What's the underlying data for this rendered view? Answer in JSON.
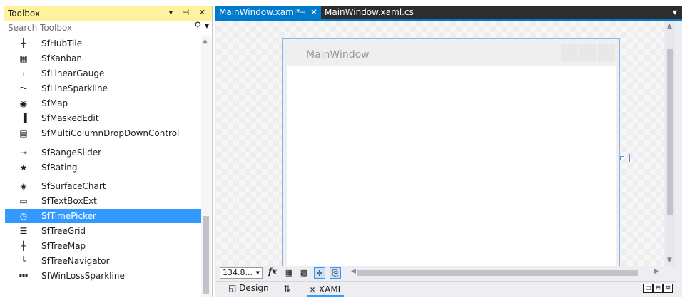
{
  "toolbox": {
    "title": "Toolbox",
    "controls": "▾ ⊣ ✕",
    "search_placeholder": "Search Toolbox",
    "items": [
      {
        "label": "SfHubTile",
        "icon": "hubtile-icon",
        "glyph": "╋"
      },
      {
        "label": "SfKanban",
        "icon": "kanban-icon",
        "glyph": "▦"
      },
      {
        "label": "SfLinearGauge",
        "icon": "linear-gauge-icon",
        "glyph": "ₗ"
      },
      {
        "label": "SfLineSparkline",
        "icon": "sparkline-icon",
        "glyph": "〜"
      },
      {
        "label": "SfMap",
        "icon": "map-icon",
        "glyph": "◉"
      },
      {
        "label": "SfMaskedEdit",
        "icon": "masked-edit-icon",
        "glyph": "▐"
      },
      {
        "label": "SfMultiColumnDropDownControl",
        "icon": "multicolumn-dropdown-icon",
        "glyph": "▤"
      },
      {
        "label": "SfRangeSlider",
        "icon": "range-slider-icon",
        "glyph": "⊸"
      },
      {
        "label": "SfRating",
        "icon": "rating-star-icon",
        "glyph": "★"
      },
      {
        "label": "SfSurfaceChart",
        "icon": "surface-chart-icon",
        "glyph": "◈"
      },
      {
        "label": "SfTextBoxExt",
        "icon": "textbox-icon",
        "glyph": "▭"
      },
      {
        "label": "SfTimePicker",
        "icon": "clock-icon",
        "glyph": "◷",
        "selected": true
      },
      {
        "label": "SfTreeGrid",
        "icon": "tree-grid-icon",
        "glyph": "☰"
      },
      {
        "label": "SfTreeMap",
        "icon": "treemap-icon",
        "glyph": "╂"
      },
      {
        "label": "SfTreeNavigator",
        "icon": "tree-navigator-icon",
        "glyph": "└"
      },
      {
        "label": "SfWinLossSparkline",
        "icon": "winloss-sparkline-icon",
        "glyph": "▪▪▪"
      }
    ]
  },
  "editor": {
    "tabs": [
      {
        "label": "MainWindow.xaml*",
        "active": true
      },
      {
        "label": "MainWindow.xaml.cs",
        "active": false
      }
    ],
    "window_title": "MainWindow",
    "zoom": "134.8...",
    "fx": "fx",
    "view_tabs": {
      "design": "Design",
      "xaml": "XAML"
    }
  },
  "colors": {
    "toolbox_header": "#fff29d",
    "selection": "#3399ff",
    "accent": "#007acc",
    "tab_bar": "#2d2d30"
  }
}
